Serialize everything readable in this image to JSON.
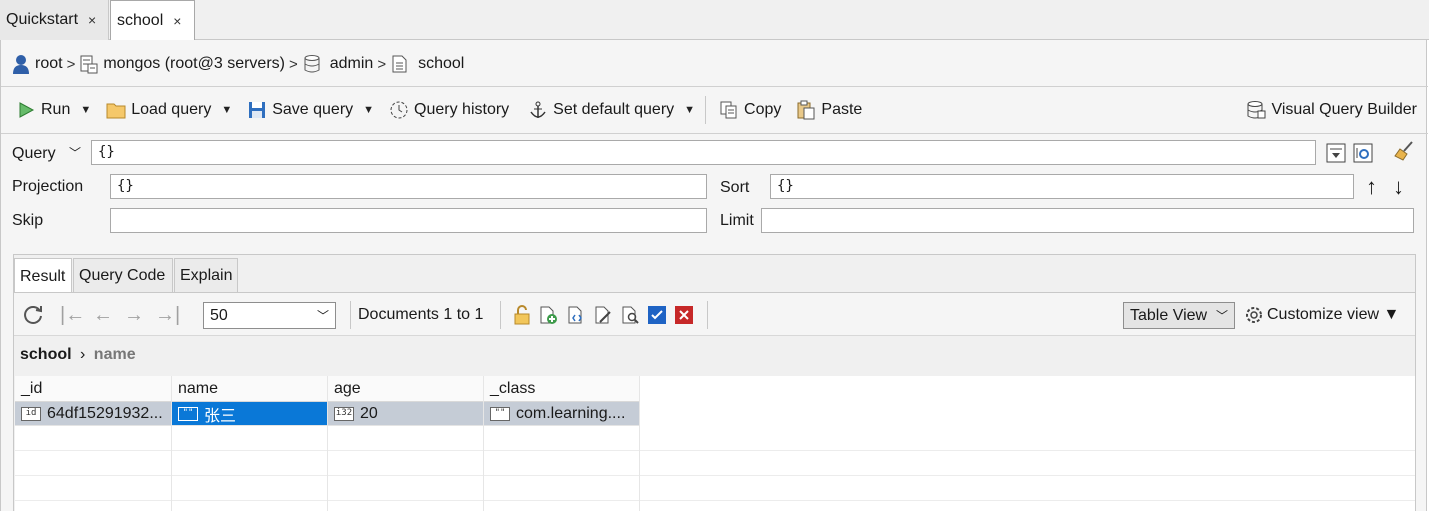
{
  "tabs": [
    {
      "label": "Quickstart",
      "close": "×"
    },
    {
      "label": "school",
      "close": "×"
    }
  ],
  "breadcrumb": {
    "user": "root",
    "server": "mongos (root@3 servers)",
    "database": "admin",
    "collection": "school",
    "sep": ">"
  },
  "toolbar": {
    "run": "Run",
    "load_query": "Load query",
    "save_query": "Save query",
    "query_history": "Query history",
    "set_default_query": "Set default query",
    "copy": "Copy",
    "paste": "Paste",
    "visual_query_builder": "Visual Query Builder"
  },
  "query_form": {
    "query_label": "Query",
    "query_value": "{}",
    "projection_label": "Projection",
    "projection_value": "{}",
    "sort_label": "Sort",
    "sort_value": "{}",
    "skip_label": "Skip",
    "skip_value": "",
    "limit_label": "Limit",
    "limit_value": ""
  },
  "result_tabs": [
    "Result",
    "Query Code",
    "Explain"
  ],
  "result_toolbar": {
    "page_size": "50",
    "documents_text": "Documents 1 to 1",
    "view_mode": "Table View",
    "customize_view": "Customize view ▼"
  },
  "result_path": {
    "collection": "school",
    "field": "name"
  },
  "table": {
    "columns": [
      "_id",
      "name",
      "age",
      "_class"
    ],
    "rows": [
      {
        "_id": {
          "type_icon": "id",
          "value": "64df15291932..."
        },
        "name": {
          "type_icon": "\"\"",
          "value": "张三"
        },
        "age": {
          "type_icon": "i32",
          "value": "20"
        },
        "_class": {
          "type_icon": "\"\"",
          "value": "com.learning...."
        }
      }
    ]
  },
  "colors": {
    "selection_cell": "#0a78d7",
    "selection_row": "#c5ccd6",
    "run_icon": "#4caf50",
    "delete_icon": "#c62828",
    "checkbox_icon": "#1e63c4"
  }
}
